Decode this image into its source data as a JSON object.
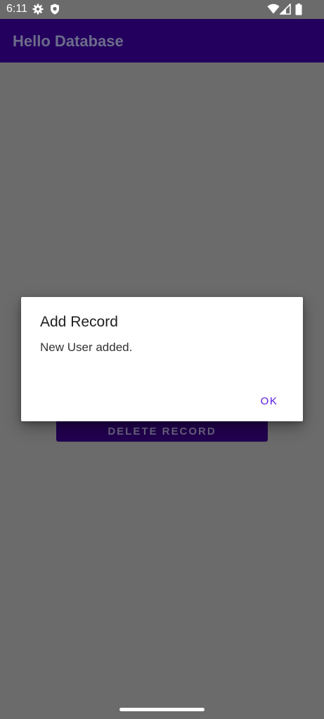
{
  "status_bar": {
    "time": "6:11",
    "icons": [
      "gear-icon",
      "shield-icon",
      "wifi-icon",
      "signal-icon",
      "battery-icon"
    ]
  },
  "app_bar": {
    "title": "Hello Database"
  },
  "main": {
    "delete_button_label": "DELETE RECORD"
  },
  "dialog": {
    "title": "Add Record",
    "message": "New User added.",
    "ok_label": "OK"
  },
  "colors": {
    "app_bar": "#23005e",
    "scrim_background": "#6b6b6b",
    "button_background": "#22004f",
    "dialog_accent": "#5a18e0"
  }
}
